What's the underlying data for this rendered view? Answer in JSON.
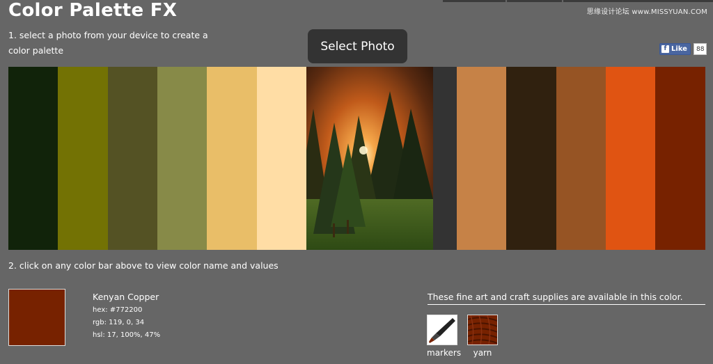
{
  "app": {
    "title": "Color Palette FX",
    "watermark": "思缘设计论坛 www.MISSYUAN.COM"
  },
  "top_tabs": [
    "",
    "",
    ""
  ],
  "step1": {
    "text": "1. select a photo from your device to create a color palette",
    "select_button": "Select Photo"
  },
  "facebook": {
    "like_label": "Like",
    "count": "88"
  },
  "palette": {
    "colors": [
      "#11230a",
      "#737204",
      "#545224",
      "#878a48",
      "#e9be68",
      "#ffdda5",
      "#333333",
      "#c68247",
      "#30210f",
      "#965424",
      "#e05412",
      "#772200"
    ],
    "photo_description_icon": "sunset-forest-photo"
  },
  "step2": {
    "text": "2. click on any color bar above to view color name and values"
  },
  "selected_color": {
    "name": "Kenyan Copper",
    "hex": "hex: #772200",
    "rgb": "rgb: 119, 0, 34",
    "hsl": "hsl: 17, 100%, 47%",
    "swatch": "#772200"
  },
  "supplies": {
    "title": "These fine art and craft supplies are available in this color.",
    "items": [
      {
        "label": "markers",
        "icon": "marker-icon"
      },
      {
        "label": "yarn",
        "icon": "yarn-icon"
      }
    ]
  }
}
